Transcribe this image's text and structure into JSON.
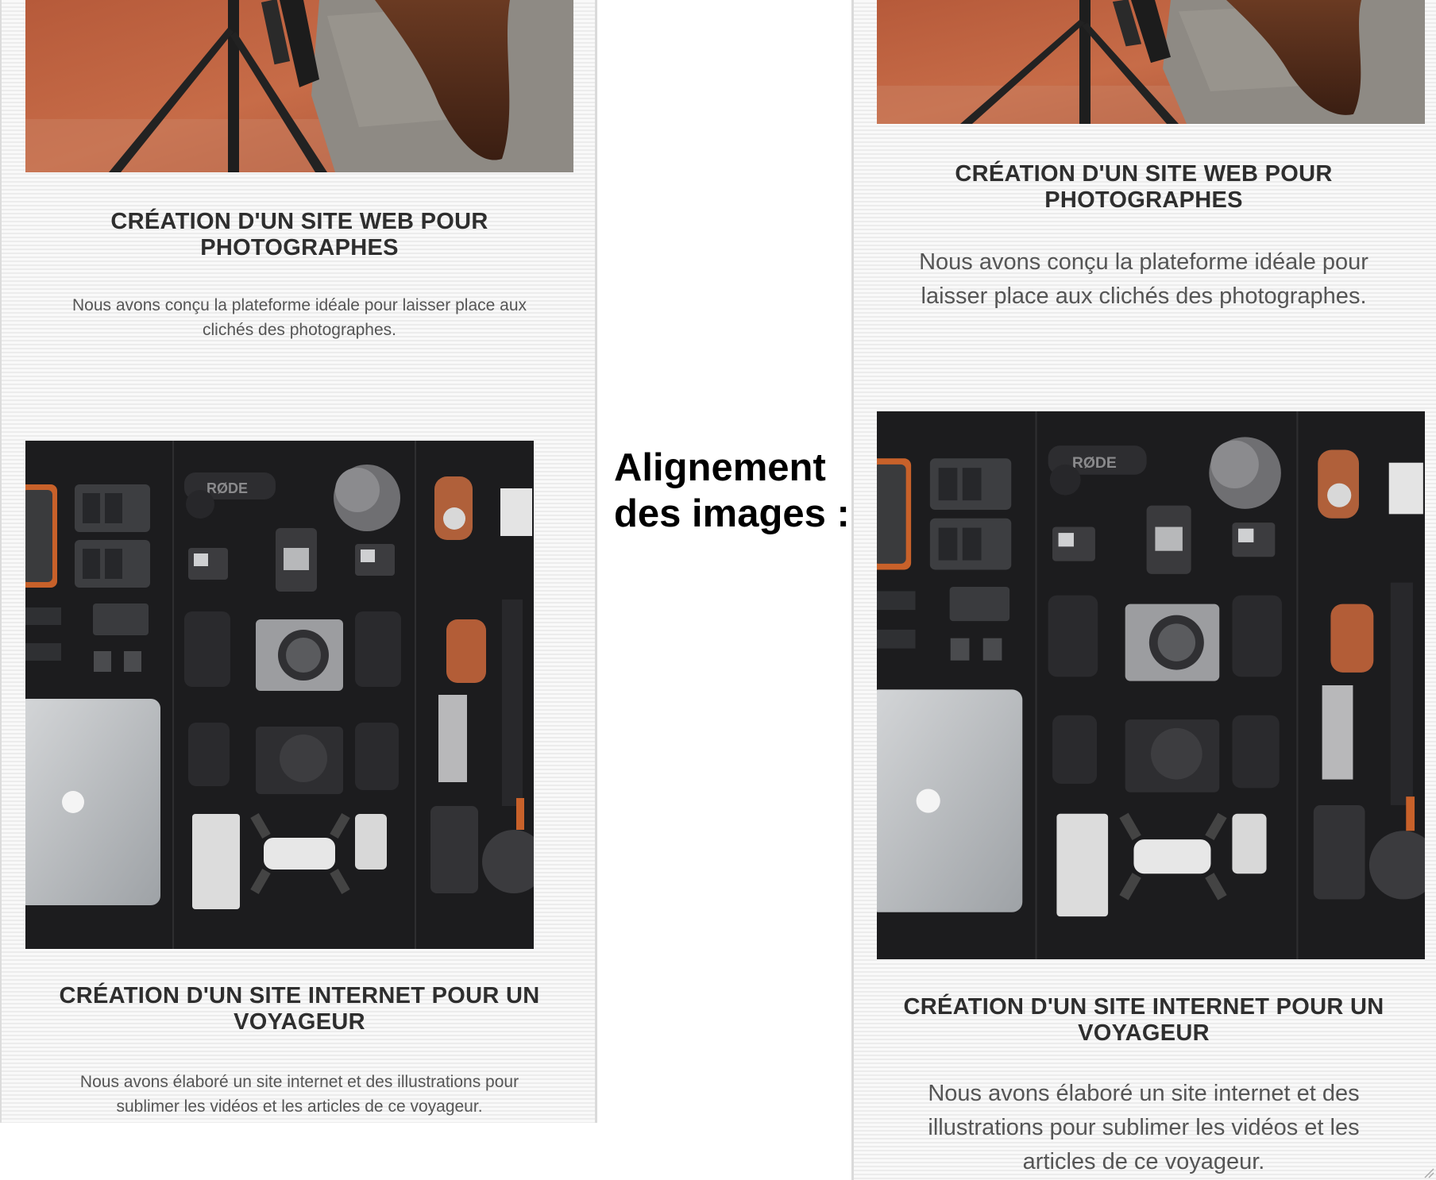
{
  "center_label": "Alignement des images :",
  "left_column": {
    "projects": [
      {
        "title": "CRÉATION D'UN SITE WEB POUR PHOTOGRAPHES",
        "description": "Nous avons conçu la plateforme idéale pour laisser place aux clichés des photographes."
      },
      {
        "title": "CRÉATION D'UN SITE INTERNET POUR UN VOYAGEUR",
        "description": "Nous avons élaboré un site internet et des illustrations pour sublimer les vidéos et les articles de ce voyageur."
      }
    ]
  },
  "right_column": {
    "projects": [
      {
        "title": "CRÉATION D'UN SITE WEB POUR PHOTOGRAPHES",
        "description": "Nous avons conçu la plateforme idéale pour laisser place aux clichés des photographes."
      },
      {
        "title": "CRÉATION D'UN SITE INTERNET POUR UN VOYAGEUR",
        "description": "Nous avons élaboré un site internet et des illustrations pour sublimer les vidéos et les articles de ce voyageur."
      }
    ]
  }
}
